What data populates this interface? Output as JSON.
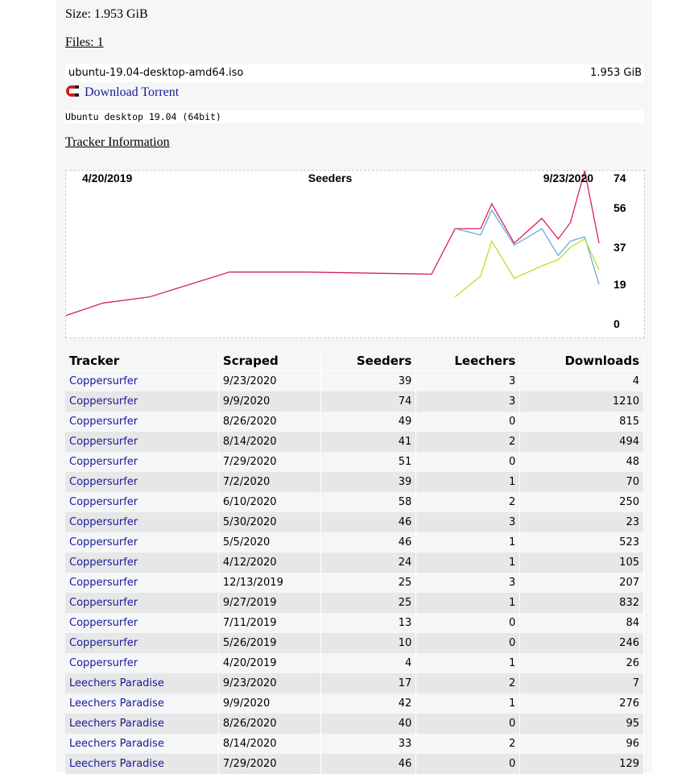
{
  "details": {
    "size_line": "Size: 1.953 GiB",
    "files_line": "Files: 1",
    "file": {
      "name": "ubuntu-19.04-desktop-amd64.iso",
      "size": "1.953 GiB"
    },
    "download_label": "Download Torrent",
    "description": "Ubuntu desktop 19.04 (64bit)",
    "tracker_heading": "Tracker Information"
  },
  "chart_data": {
    "type": "line",
    "title": "Seeders",
    "x_start_label": "4/20/2019",
    "x_end_label": "9/23/2020",
    "y_tick_labels": [
      "74",
      "56",
      "37",
      "19",
      "0"
    ],
    "ylim": [
      0,
      74
    ],
    "grid": false,
    "colors": {
      "Coppersurfer": "#d6205a",
      "Leechers Paradise": "#6aa8e0",
      "series3": "#b8e02a"
    },
    "series": [
      {
        "name": "Coppersurfer",
        "points": [
          [
            "4/20/2019",
            4
          ],
          [
            "5/26/2019",
            10
          ],
          [
            "7/11/2019",
            13
          ],
          [
            "9/27/2019",
            25
          ],
          [
            "12/13/2019",
            25
          ],
          [
            "4/12/2020",
            24
          ],
          [
            "5/5/2020",
            46
          ],
          [
            "5/30/2020",
            46
          ],
          [
            "6/10/2020",
            58
          ],
          [
            "7/2/2020",
            39
          ],
          [
            "7/29/2020",
            51
          ],
          [
            "8/14/2020",
            41
          ],
          [
            "8/26/2020",
            49
          ],
          [
            "9/9/2020",
            74
          ],
          [
            "9/23/2020",
            39
          ]
        ]
      },
      {
        "name": "Leechers Paradise",
        "points": [
          [
            "5/5/2020",
            46
          ],
          [
            "5/30/2020",
            43
          ],
          [
            "6/10/2020",
            55
          ],
          [
            "7/2/2020",
            38
          ],
          [
            "7/29/2020",
            46
          ],
          [
            "8/14/2020",
            33
          ],
          [
            "8/26/2020",
            40
          ],
          [
            "9/9/2020",
            42
          ],
          [
            "9/23/2020",
            19
          ]
        ]
      },
      {
        "name": "",
        "points": [
          [
            "5/5/2020",
            13
          ],
          [
            "5/30/2020",
            23
          ],
          [
            "6/10/2020",
            40
          ],
          [
            "7/2/2020",
            22
          ],
          [
            "7/29/2020",
            28
          ],
          [
            "8/14/2020",
            31
          ],
          [
            "8/26/2020",
            37
          ],
          [
            "9/9/2020",
            41
          ],
          [
            "9/23/2020",
            26
          ]
        ]
      }
    ]
  },
  "table": {
    "headers": [
      "Tracker",
      "Scraped",
      "Seeders",
      "Leechers",
      "Downloads"
    ],
    "rows": [
      [
        "Coppersurfer",
        "9/23/2020",
        "39",
        "3",
        "4"
      ],
      [
        "Coppersurfer",
        "9/9/2020",
        "74",
        "3",
        "1210"
      ],
      [
        "Coppersurfer",
        "8/26/2020",
        "49",
        "0",
        "815"
      ],
      [
        "Coppersurfer",
        "8/14/2020",
        "41",
        "2",
        "494"
      ],
      [
        "Coppersurfer",
        "7/29/2020",
        "51",
        "0",
        "48"
      ],
      [
        "Coppersurfer",
        "7/2/2020",
        "39",
        "1",
        "70"
      ],
      [
        "Coppersurfer",
        "6/10/2020",
        "58",
        "2",
        "250"
      ],
      [
        "Coppersurfer",
        "5/30/2020",
        "46",
        "3",
        "23"
      ],
      [
        "Coppersurfer",
        "5/5/2020",
        "46",
        "1",
        "523"
      ],
      [
        "Coppersurfer",
        "4/12/2020",
        "24",
        "1",
        "105"
      ],
      [
        "Coppersurfer",
        "12/13/2019",
        "25",
        "3",
        "207"
      ],
      [
        "Coppersurfer",
        "9/27/2019",
        "25",
        "1",
        "832"
      ],
      [
        "Coppersurfer",
        "7/11/2019",
        "13",
        "0",
        "84"
      ],
      [
        "Coppersurfer",
        "5/26/2019",
        "10",
        "0",
        "246"
      ],
      [
        "Coppersurfer",
        "4/20/2019",
        "4",
        "1",
        "26"
      ],
      [
        "Leechers Paradise",
        "9/23/2020",
        "17",
        "2",
        "7"
      ],
      [
        "Leechers Paradise",
        "9/9/2020",
        "42",
        "1",
        "276"
      ],
      [
        "Leechers Paradise",
        "8/26/2020",
        "40",
        "0",
        "95"
      ],
      [
        "Leechers Paradise",
        "8/14/2020",
        "33",
        "2",
        "96"
      ],
      [
        "Leechers Paradise",
        "7/29/2020",
        "46",
        "0",
        "129"
      ]
    ]
  },
  "icons": {
    "download": "magnet-icon"
  }
}
